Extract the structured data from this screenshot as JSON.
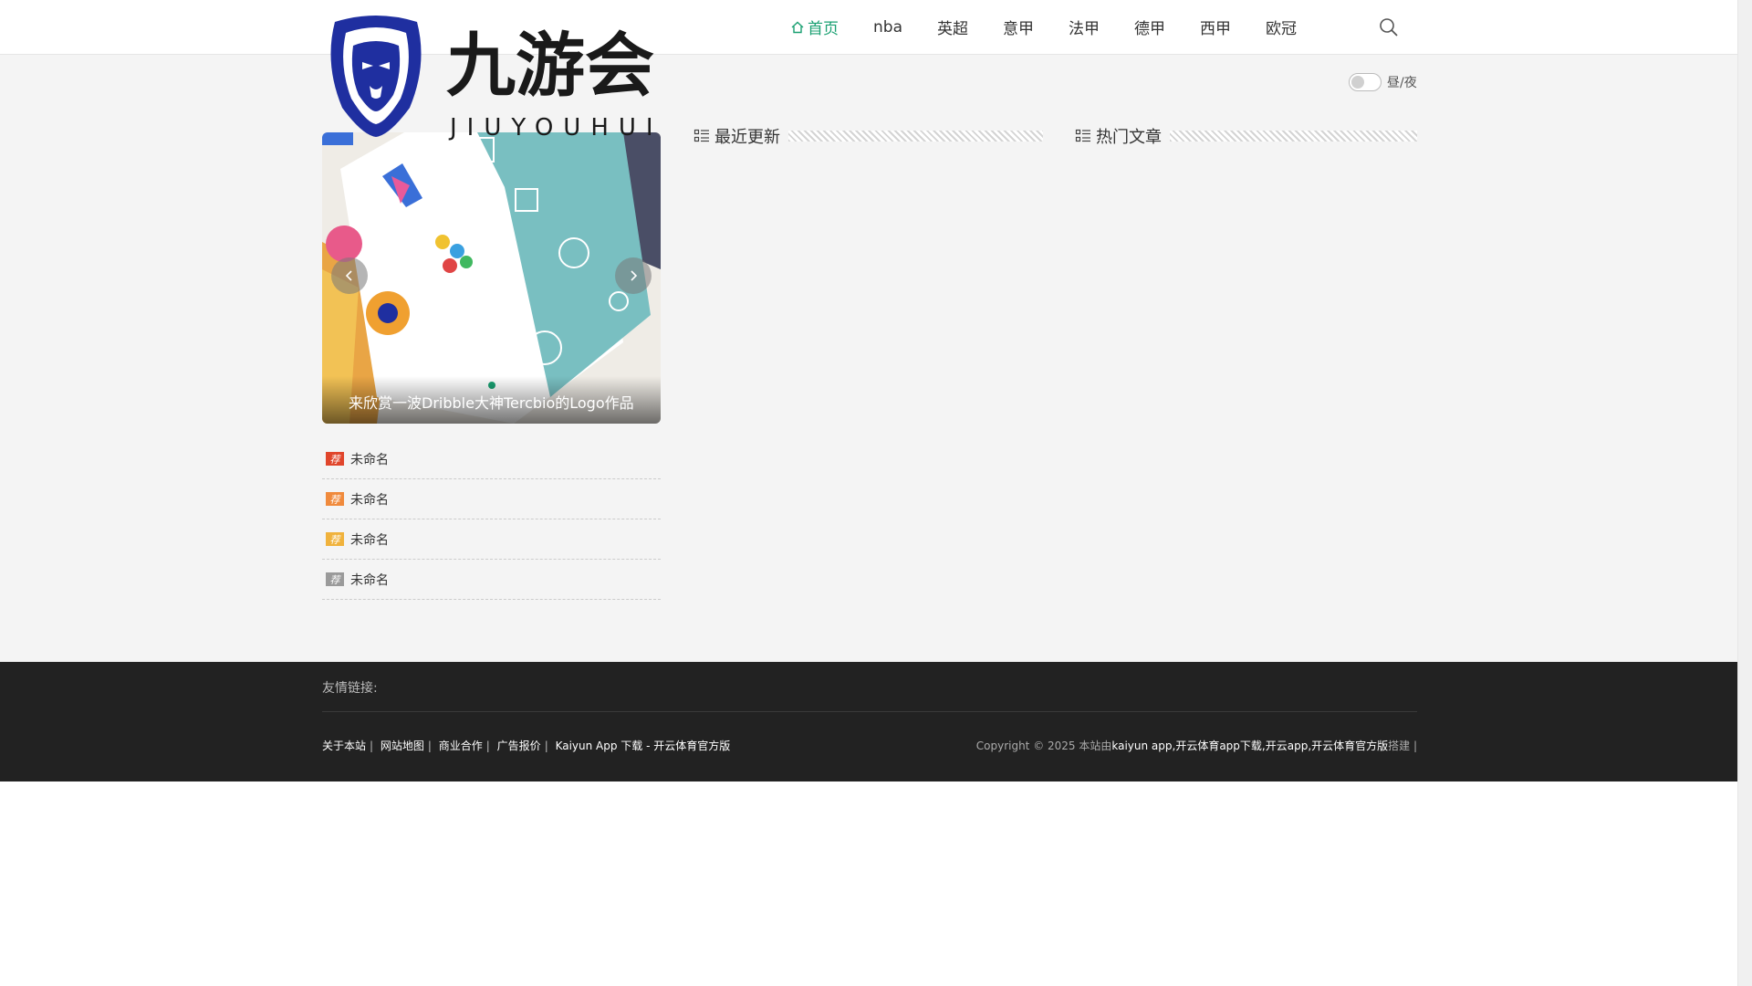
{
  "brand": {
    "logo_text_cn": "九游会",
    "logo_text_en": "JIUYOUHUI",
    "colors": {
      "accent": "#1aa072",
      "logo_blue": "#1f2fa0",
      "footer_bg": "#222222"
    }
  },
  "nav": {
    "items": [
      {
        "label": "首页",
        "icon": "home-icon"
      },
      {
        "label": "nba"
      },
      {
        "label": "英超"
      },
      {
        "label": "意甲"
      },
      {
        "label": "法甲"
      },
      {
        "label": "德甲"
      },
      {
        "label": "西甲"
      },
      {
        "label": "欧冠"
      }
    ],
    "search_icon": "search-icon"
  },
  "theme_toggle": {
    "label": "昼/夜"
  },
  "slider": {
    "caption": "来欣赏一波Dribble大神Tercbio的Logo作品",
    "slides_total": 1,
    "active_index": 1
  },
  "recommended": {
    "tag_label": "荐",
    "tag_colors": [
      "#e0452b",
      "#f08a3c",
      "#f0b23c",
      "#9a9a9a"
    ],
    "items": [
      {
        "title": "未命名"
      },
      {
        "title": "未命名"
      },
      {
        "title": "未命名"
      },
      {
        "title": "未命名"
      }
    ]
  },
  "sections": {
    "recent_title": "最近更新",
    "hot_title": "热门文章"
  },
  "footer": {
    "friend_links_label": "友情链接:",
    "links": [
      {
        "label": "关于本站"
      },
      {
        "label": "网站地图"
      },
      {
        "label": "商业合作"
      },
      {
        "label": "广告报价"
      },
      {
        "label": "Kaiyun App 下载 - 开云体育官方版"
      }
    ],
    "copyright_prefix": "Copyright © 2025 本站由",
    "copyright_site": "kaiyun app,开云体育app下载,开云app,开云体育官方版",
    "copyright_suffix": "搭建 |"
  }
}
